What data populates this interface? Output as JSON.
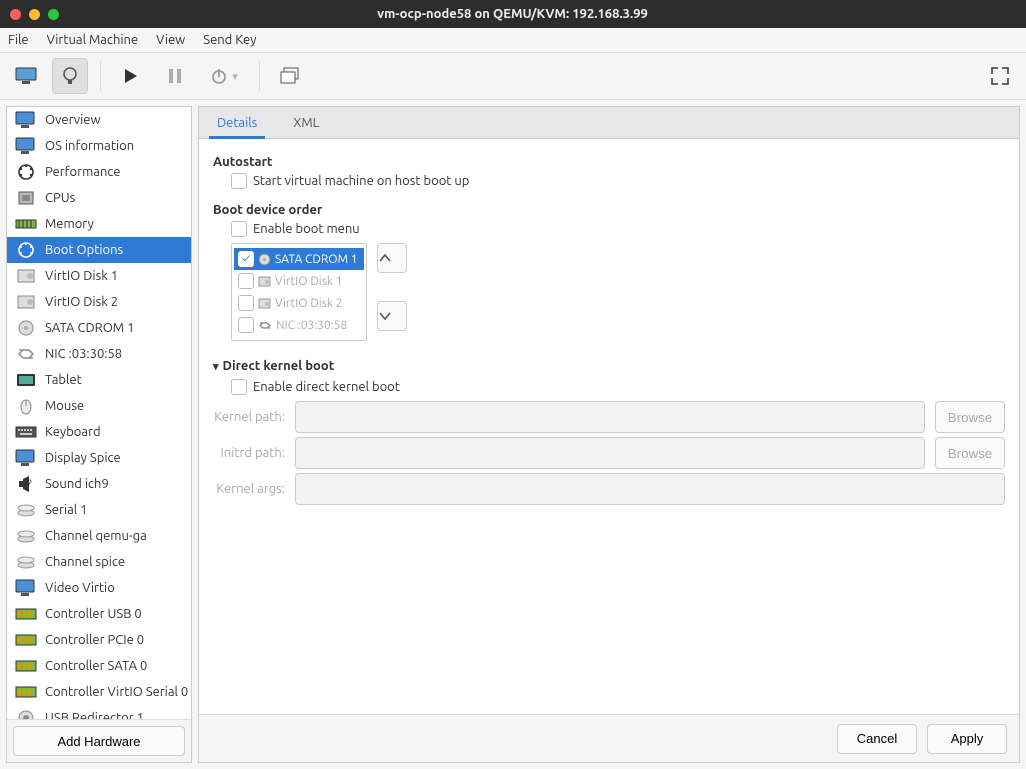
{
  "title": "vm-ocp-node58 on QEMU/KVM: 192.168.3.99",
  "menubar": {
    "file": "File",
    "vm": "Virtual Machine",
    "view": "View",
    "sendkey": "Send Key"
  },
  "sidebar": {
    "items": [
      {
        "label": "Overview",
        "key": "overview"
      },
      {
        "label": "OS information",
        "key": "osinfo"
      },
      {
        "label": "Performance",
        "key": "performance"
      },
      {
        "label": "CPUs",
        "key": "cpus"
      },
      {
        "label": "Memory",
        "key": "memory"
      },
      {
        "label": "Boot Options",
        "key": "boot",
        "selected": true
      },
      {
        "label": "VirtIO Disk 1",
        "key": "vdisk1"
      },
      {
        "label": "VirtIO Disk 2",
        "key": "vdisk2"
      },
      {
        "label": "SATA CDROM 1",
        "key": "cdrom"
      },
      {
        "label": "NIC :03:30:58",
        "key": "nic"
      },
      {
        "label": "Tablet",
        "key": "tablet"
      },
      {
        "label": "Mouse",
        "key": "mouse"
      },
      {
        "label": "Keyboard",
        "key": "keyboard"
      },
      {
        "label": "Display Spice",
        "key": "display"
      },
      {
        "label": "Sound ich9",
        "key": "sound"
      },
      {
        "label": "Serial 1",
        "key": "serial"
      },
      {
        "label": "Channel qemu-ga",
        "key": "chanqemu"
      },
      {
        "label": "Channel spice",
        "key": "chanspice"
      },
      {
        "label": "Video Virtio",
        "key": "video"
      },
      {
        "label": "Controller USB 0",
        "key": "ctlusb"
      },
      {
        "label": "Controller PCIe 0",
        "key": "ctlpcie"
      },
      {
        "label": "Controller SATA 0",
        "key": "ctlsata"
      },
      {
        "label": "Controller VirtIO Serial 0",
        "key": "ctlvserial"
      },
      {
        "label": "USB Redirector 1",
        "key": "usbredir"
      }
    ],
    "add_label": "Add Hardware"
  },
  "tabs": {
    "details": "Details",
    "xml": "XML"
  },
  "details": {
    "autostart_title": "Autostart",
    "autostart_label": "Start virtual machine on host boot up",
    "autostart_checked": false,
    "boot_order_title": "Boot device order",
    "enable_boot_menu_label": "Enable boot menu",
    "enable_boot_menu_checked": false,
    "boot_devices": [
      {
        "label": "SATA CDROM 1",
        "checked": true,
        "selected": true,
        "icon": "cd"
      },
      {
        "label": "VirtIO Disk 1",
        "checked": false,
        "selected": false,
        "icon": "disk"
      },
      {
        "label": "VirtIO Disk 2",
        "checked": false,
        "selected": false,
        "icon": "disk"
      },
      {
        "label": "NIC :03:30:58",
        "checked": false,
        "selected": false,
        "icon": "nic"
      }
    ],
    "kernel_section": "Direct kernel boot",
    "kernel_enable_label": "Enable direct kernel boot",
    "kernel_enable_checked": false,
    "kernel_path_label": "Kernel path:",
    "initrd_path_label": "Initrd path:",
    "kernel_args_label": "Kernel args:",
    "browse_label": "Browse"
  },
  "footer": {
    "cancel": "Cancel",
    "apply": "Apply"
  }
}
